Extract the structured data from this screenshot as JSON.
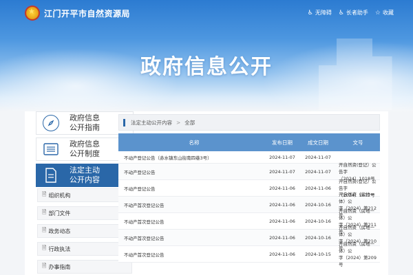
{
  "header": {
    "site_title": "江门开平市自然资源局",
    "tools": [
      {
        "icon": "accessibility-icon",
        "label": "无障碍"
      },
      {
        "icon": "elderly-icon",
        "label": "长者助手"
      },
      {
        "icon": "star-icon",
        "label": "收藏"
      }
    ],
    "page_heading": "政府信息公开"
  },
  "sidebar": {
    "cards": [
      {
        "label": "政府信息\n公开指南",
        "icon": "compass-icon",
        "active": false
      },
      {
        "label": "政府信息\n公开制度",
        "icon": "list-icon",
        "active": false
      },
      {
        "label": "法定主动\n公开内容",
        "icon": "document-icon",
        "active": true
      }
    ],
    "subitems": [
      {
        "label": "组织机构",
        "expandable": true
      },
      {
        "label": "部门文件",
        "expandable": false
      },
      {
        "label": "政务动态",
        "expandable": false
      },
      {
        "label": "行政执法",
        "expandable": true
      },
      {
        "label": "办事指南",
        "expandable": false
      }
    ]
  },
  "breadcrumb": {
    "items": [
      "法定主动公开内容",
      "全部"
    ]
  },
  "table": {
    "headers": [
      "名称",
      "发布日期",
      "成文日期",
      "文号"
    ],
    "rows": [
      {
        "name": "不动产登记公告（赤水镇东山街南四巷3号）",
        "pub": "2024-11-07",
        "done": "2024-11-07",
        "no": ""
      },
      {
        "name": "不动产登记公告",
        "pub": "2024-11-07",
        "done": "2024-11-07",
        "no": "开自然资(登记）公告字\n（2024）1018号"
      },
      {
        "name": "不动产登记公告",
        "pub": "2024-11-06",
        "done": "2024-11-06",
        "no": "开自然资(登记）公告字\n（2024）1017号"
      },
      {
        "name": "不动产首次登记公告",
        "pub": "2024-11-06",
        "done": "2024-10-16",
        "no": "开自然资（房地一体）公\n字（2024）第212号"
      },
      {
        "name": "不动产首次登记公告",
        "pub": "2024-11-06",
        "done": "2024-10-16",
        "no": "开自然资（房地一体）公\n字（2024）第211号"
      },
      {
        "name": "不动产首次登记公告",
        "pub": "2024-11-06",
        "done": "2024-10-16",
        "no": "开自然资（房地一体）公\n字（2024）第210号"
      },
      {
        "name": "不动产首次登记公告",
        "pub": "2024-11-06",
        "done": "2024-10-15",
        "no": "开自然资（房地一体）公\n字（2024）第209号"
      }
    ]
  }
}
